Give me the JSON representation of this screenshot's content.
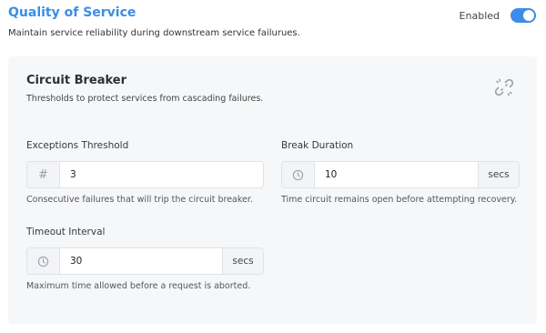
{
  "header": {
    "title": "Quality of Service",
    "description": "Maintain service reliability during downstream service failurues.",
    "toggle_label": "Enabled",
    "toggle_on": true
  },
  "card": {
    "title": "Circuit Breaker",
    "description": "Thresholds to protect services from cascading failures.",
    "icon": "broken-link-icon"
  },
  "fields": {
    "exceptions": {
      "label": "Exceptions Threshold",
      "icon": "hash-icon",
      "value": "3",
      "help": "Consecutive failures that will trip the circuit breaker."
    },
    "break_duration": {
      "label": "Break Duration",
      "icon": "clock-icon",
      "value": "10",
      "unit": "secs",
      "help": "Time circuit remains open before attempting recovery."
    },
    "timeout": {
      "label": "Timeout Interval",
      "icon": "clock-icon",
      "value": "30",
      "unit": "secs",
      "help": "Maximum time allowed before a request is aborted."
    }
  },
  "colors": {
    "accent": "#3b8de6",
    "card_bg": "#f6f7f9"
  }
}
